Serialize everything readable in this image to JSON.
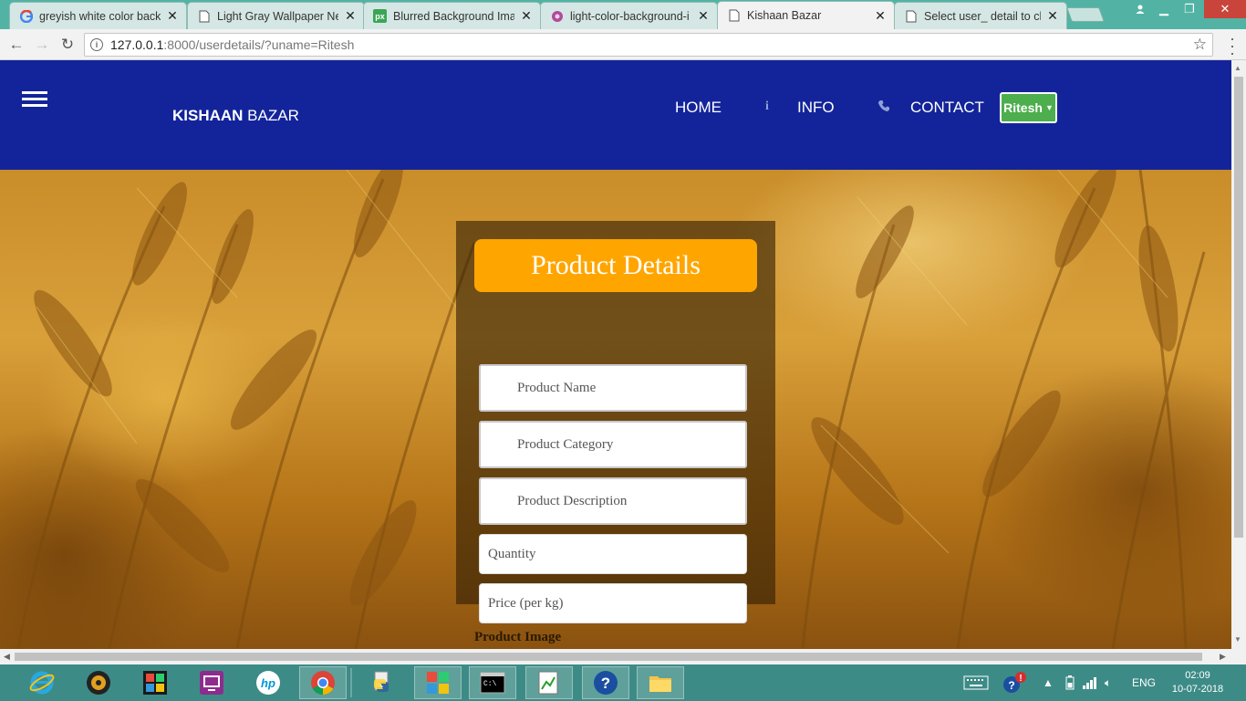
{
  "browser": {
    "tabs": [
      {
        "title": "greyish white color backg",
        "icon": "google-icon",
        "active": false
      },
      {
        "title": "Light Gray Wallpaper Nev",
        "icon": "page-icon",
        "active": false
      },
      {
        "title": "Blurred Background Imag",
        "icon": "px-icon",
        "active": false
      },
      {
        "title": "light-color-background-i",
        "icon": "flower-icon",
        "active": false
      },
      {
        "title": "Kishaan Bazar",
        "icon": "page-icon",
        "active": true
      },
      {
        "title": "Select user_ detail to cha",
        "icon": "page-icon",
        "active": false
      }
    ],
    "url_host": "127.0.0.1",
    "url_rest": ":8000/userdetails/?uname=Ritesh"
  },
  "site": {
    "brand_bold": "KISHAAN",
    "brand_rest": " BAZAR",
    "nav": {
      "home": "HOME",
      "info": "INFO",
      "contact": "CONTACT"
    },
    "user": "Ritesh"
  },
  "form": {
    "title": "Product Details",
    "product_name_placeholder": "Product Name",
    "product_category_placeholder": "Product Category",
    "product_description_placeholder": "Product Description",
    "quantity_placeholder": "Quantity",
    "price_placeholder": "Price (per kg)",
    "image_label": "Product Image"
  },
  "taskbar": {
    "language": "ENG",
    "time": "02:09",
    "date": "10-07-2018"
  },
  "colors": {
    "nav_bg": "#13249a",
    "title_bg": "#ffa500",
    "user_btn": "#4cae4c",
    "taskbar": "#3d8b86"
  }
}
